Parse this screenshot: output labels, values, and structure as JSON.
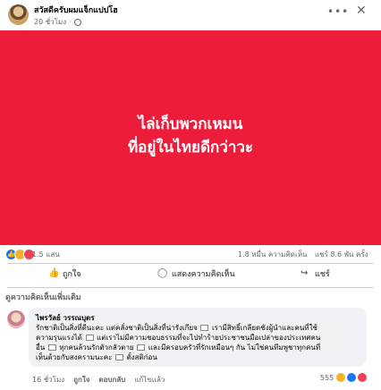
{
  "post": {
    "author": "สวัสดีครับผมแจ็กแปปโฮ",
    "time": "20 ชั่วโมง",
    "banner_line1": "ไล่เก็บพวกเหมน",
    "banner_line2": "ที่อยู่ในไทยดีกว่าวะ",
    "banner_color": "#ed1c3a"
  },
  "stats": {
    "reactions": "1.5 แสน",
    "comments": "1.8 หมื่น ความคิดเห็น",
    "shares": "แชร์ 8.6 พัน ครั้ง"
  },
  "actions": {
    "like": "ถูกใจ",
    "comment": "แสดงความคิดเห็น",
    "share": "แชร์"
  },
  "comments_section": {
    "view_more": "ดูความคิดเห็นเพิ่มเติม"
  },
  "comment": {
    "author": "ไพรวัลย์ วรรณบุตร",
    "lines": [
      "รักชาติเป็นสิ่งที่ดีนะคะ แต่คลั่งชาติเป็นสิ่งที่น่ารังเกียจ",
      "ความรุนแรงได้",
      "อื่น",
      "เห็นด้วยกับสงครามนะคะ"
    ],
    "line1_tail": "เรามีสิทธิ์เกลียดชังผู้นำและคนที่ใช้",
    "line2_tail": "แต่เราไม่มีความชอบธรรมที่จะไปทำร้ายประชาชนมือเปล่าของประเทศคน",
    "line3_tail": "ทุกคนล้วนรักตัวกลัวตาย",
    "line3_tail2": "และมีครอบครัวที่รักเหมือนๆ กัน ไม่ใช่คนทีมพูชาทุกคนที่",
    "line4_tail": "ตั้งสติก่อน",
    "time": "16 ชั่วโมง",
    "like": "ถูกใจ",
    "reply": "ตอบกลับ",
    "edited": "แก้ไขแล้ว",
    "reaction_count": "555"
  },
  "colors": {
    "like_blue": "#1877f2",
    "haha_yellow": "#f7b125",
    "love_red": "#f33e58"
  }
}
